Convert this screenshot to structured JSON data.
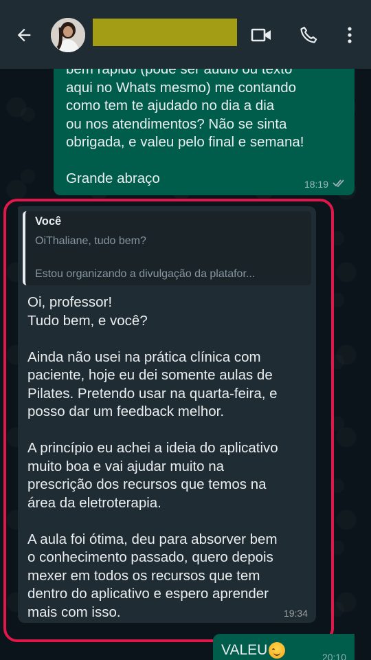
{
  "header": {
    "contact_name": "",
    "icons": [
      "back-arrow-icon",
      "avatar",
      "video-call-icon",
      "phone-icon",
      "more-vert-icon"
    ]
  },
  "messages": {
    "top_outgoing": {
      "text": "bem rápido (pode ser áudio ou texto\naqui no Whats mesmo) me contando\ncomo tem te ajudado no dia a dia\nou nos atendimentos? Não se sinta\nobrigada, e valeu pelo final e semana!\n\nGrande abraço",
      "time": "18:19",
      "status": "read"
    },
    "incoming": {
      "quote_author": "Você",
      "quote_line1": "OiThaliane, tudo bem?",
      "quote_line2": "Estou organizando a divulgação da platafor...",
      "text": "Oi, professor!\nTudo bem, e você?\n\nAinda não usei na prática clínica com\npaciente, hoje eu dei somente aulas de\nPilates. Pretendo usar na quarta-feira, e\nposso dar um feedback melhor.\n\nA princípio eu achei a ideia do aplicativo\nmuito boa e vai ajudar muito na\nprescrição dos recursos que temos na\nárea da eletroterapia.\n\nA aula foi ótima, deu para absorver bem\no conhecimento passado, quero depois\nmexer em todos os recursos que tem\ndentro do aplicativo e espero aprender\nmais com isso.",
      "time": "19:34"
    },
    "bottom_outgoing": {
      "text": "VALEU",
      "emoji": "smiling-face-icon",
      "time": "20:10"
    }
  },
  "colors": {
    "header_bg": "#1f2c33",
    "outgoing_bubble": "#005c4b",
    "incoming_bubble": "#202c33",
    "highlight_border": "#e0174a",
    "redaction": "#a39d16"
  }
}
